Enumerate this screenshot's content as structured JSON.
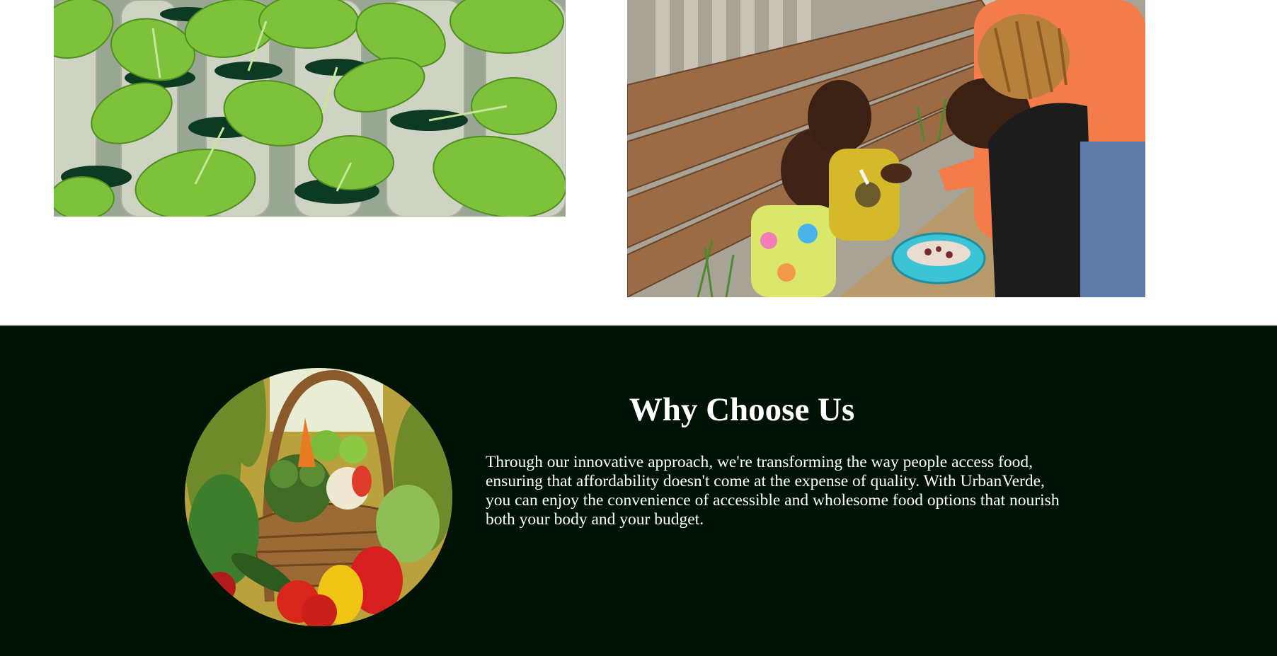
{
  "gallery": {
    "images": [
      {
        "subject": "hydroponic-leafy-greens",
        "colors": {
          "leaf": "#7dc23a",
          "pipe": "#cfd3c4"
        }
      },
      {
        "subject": "woman-feeding-children",
        "colors": {
          "jacket": "#f47c4a",
          "bowl": "#3cc4d6"
        }
      }
    ]
  },
  "why": {
    "title": "Why Choose Us",
    "body": "Through our innovative approach, we're transforming the way people access food, ensuring that affordability doesn't come at the expense of quality. With UrbanVerde, you can enjoy the convenience of accessible and wholesome food options that nourish both your body and your budget.",
    "image_subject": "vegetable-basket",
    "colors": {
      "background": "#011307",
      "text": "#ffffff"
    }
  }
}
